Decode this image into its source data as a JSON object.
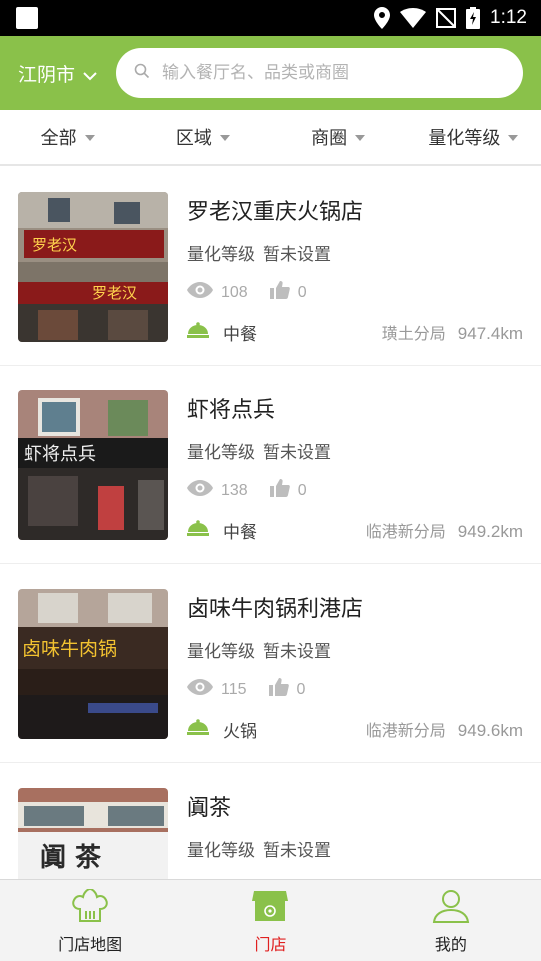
{
  "status_bar": {
    "time": "1:12"
  },
  "header": {
    "city": "江阴市",
    "search_placeholder": "输入餐厅名、品类或商圈"
  },
  "filters": [
    "全部",
    "区域",
    "商圈",
    "量化等级"
  ],
  "stores": [
    {
      "name": "罗老汉重庆火锅店",
      "grade_label": "量化等级",
      "grade_value": "暂未设置",
      "views": "108",
      "likes": "0",
      "category": "中餐",
      "bureau": "璜土分局",
      "distance": "947.4km",
      "sign_text": "罗老汉"
    },
    {
      "name": "虾将点兵",
      "grade_label": "量化等级",
      "grade_value": "暂未设置",
      "views": "138",
      "likes": "0",
      "category": "中餐",
      "bureau": "临港新分局",
      "distance": "949.2km",
      "sign_text": "虾将点兵"
    },
    {
      "name": "卤味牛肉锅利港店",
      "grade_label": "量化等级",
      "grade_value": "暂未设置",
      "views": "115",
      "likes": "0",
      "category": "火锅",
      "bureau": "临港新分局",
      "distance": "949.6km",
      "sign_text": "卤味牛肉锅"
    },
    {
      "name": "阗茶",
      "grade_label": "量化等级",
      "grade_value": "暂未设置",
      "views": "",
      "likes": "",
      "category": "",
      "bureau": "",
      "distance": "",
      "sign_text": "阗 茶"
    }
  ],
  "tabs": [
    {
      "label": "门店地图",
      "icon": "chef-hat-icon"
    },
    {
      "label": "门店",
      "icon": "storefront-icon"
    },
    {
      "label": "我的",
      "icon": "user-icon"
    }
  ],
  "colors": {
    "brand_green": "#8ac14a",
    "active_tab": "#e02020"
  }
}
